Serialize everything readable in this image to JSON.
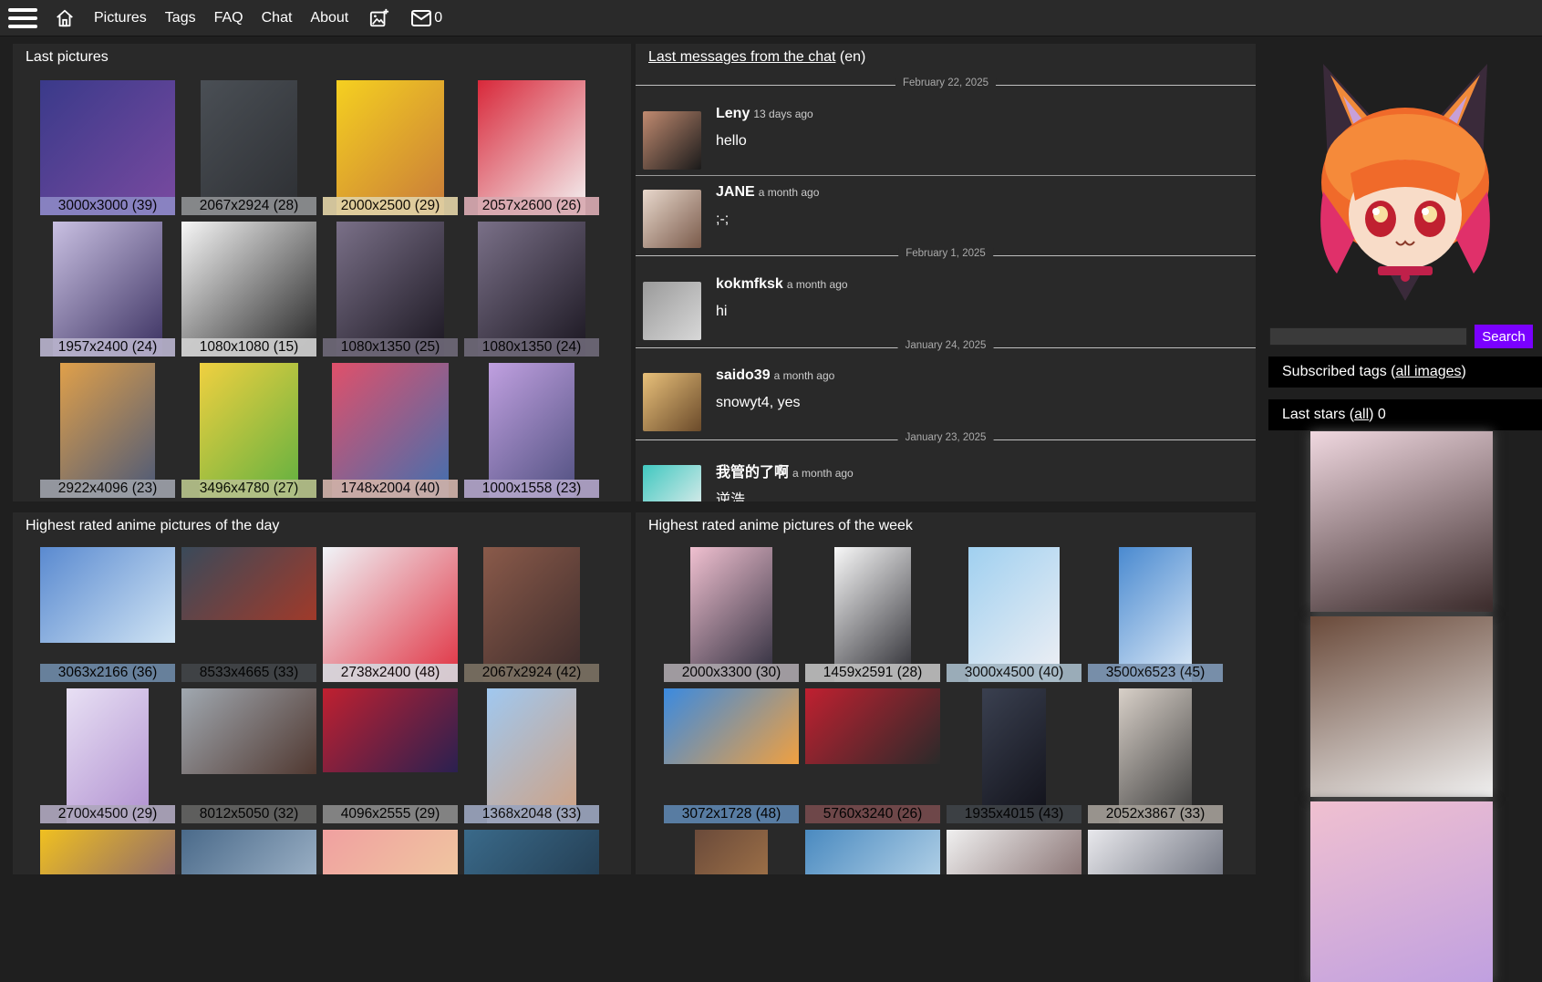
{
  "nav": {
    "links": [
      "Pictures",
      "Tags",
      "FAQ",
      "Chat",
      "About"
    ],
    "inbox_count": "0"
  },
  "last_pictures": {
    "title": "Last pictures",
    "items": [
      {
        "label": "3000x3000 (39)",
        "c1": "#3a3a8a",
        "c2": "#7a4aa0",
        "lbl": "#8b87c4",
        "w": 148,
        "h": 148
      },
      {
        "label": "2067x2924 (28)",
        "c1": "#4a4f55",
        "c2": "#2d2f33",
        "lbl": "#8d8f92",
        "w": 106,
        "h": 148
      },
      {
        "label": "2000x2500 (29)",
        "c1": "#f5d020",
        "c2": "#c87a3a",
        "lbl": "#e0d1a5",
        "w": 118,
        "h": 148
      },
      {
        "label": "2057x2600 (26)",
        "c1": "#d8283a",
        "c2": "#f4f4f4",
        "lbl": "#d8aab1",
        "w": 118,
        "h": 148
      },
      {
        "label": "1957x2400 (24)",
        "c1": "#c9c0e2",
        "c2": "#3a3060",
        "lbl": "#b8b2cc",
        "w": 120,
        "h": 148
      },
      {
        "label": "1080x1080 (15)",
        "c1": "#f6f6f6",
        "c2": "#222222",
        "lbl": "#cfcfcf",
        "w": 148,
        "h": 148
      },
      {
        "label": "1080x1350 (25)",
        "c1": "#7a7088",
        "c2": "#1a1620",
        "lbl": "#6e6878",
        "w": 118,
        "h": 148
      },
      {
        "label": "1080x1350 (24)",
        "c1": "#7a7088",
        "c2": "#1a1620",
        "lbl": "#6e6878",
        "w": 118,
        "h": 148
      },
      {
        "label": "2922x4096 (23)",
        "c1": "#e0a04a",
        "c2": "#4a5878",
        "lbl": "#9ca0a8",
        "w": 104,
        "h": 148
      },
      {
        "label": "3496x4780 (27)",
        "c1": "#f0d040",
        "c2": "#60b040",
        "lbl": "#b5c18a",
        "w": 108,
        "h": 148
      },
      {
        "label": "1748x2004 (40)",
        "c1": "#e0506a",
        "c2": "#4070b0",
        "lbl": "#cfb1a8",
        "w": 128,
        "h": 148
      },
      {
        "label": "1000x1558 (23)",
        "c1": "#c0a0e0",
        "c2": "#505080",
        "lbl": "#b1a4c9",
        "w": 94,
        "h": 148
      }
    ]
  },
  "chat": {
    "title_link": "Last messages from the chat",
    "title_suffix": " (en)",
    "dates": [
      "February 22, 2025",
      "February 1, 2025",
      "January 24, 2025",
      "January 23, 2025"
    ],
    "messages": [
      {
        "name": "Leny",
        "time": "13 days ago",
        "text": "hello",
        "c1": "#c08a70",
        "c2": "#1a1a1a"
      },
      {
        "name": "JANE",
        "time": "a month ago",
        "text": ";-;",
        "c1": "#e8d8cc",
        "c2": "#7a5a4a"
      },
      {
        "name": "kokmfksk",
        "time": "a month ago",
        "text": "hi",
        "c1": "#9a9a9a",
        "c2": "#d8d8d8"
      },
      {
        "name": "saido39",
        "time": "a month ago",
        "text": "snowyt4, yes",
        "c1": "#e8c07a",
        "c2": "#6a4a2a"
      },
      {
        "name": "我管的了啊",
        "time": "a month ago",
        "text": "逆浩",
        "c1": "#40c8c0",
        "c2": "#f0f0f0"
      }
    ]
  },
  "day_rated": {
    "title": "Highest rated anime pictures of the day",
    "items": [
      {
        "label": "3063x2166 (36)",
        "c1": "#5a8ad0",
        "c2": "#d0e4f4",
        "lbl": "#6d88a5",
        "w": 148,
        "h": 105
      },
      {
        "label": "8533x4665 (33)",
        "c1": "#3a4a5a",
        "c2": "#a03a2a",
        "lbl": "#414548",
        "w": 148,
        "h": 80
      },
      {
        "label": "2738x2400 (48)",
        "c1": "#f0f4f8",
        "c2": "#e03040",
        "lbl": "#d6d6dc",
        "w": 148,
        "h": 148
      },
      {
        "label": "2067x2924 (42)",
        "c1": "#8a5a4a",
        "c2": "#3a2a2a",
        "lbl": "#7a7062",
        "w": 106,
        "h": 148
      },
      {
        "label": "2700x4500 (29)",
        "c1": "#e8e0f4",
        "c2": "#b090d0",
        "lbl": "#aea6bd",
        "w": 90,
        "h": 148
      },
      {
        "label": "8012x5050 (32)",
        "c1": "#a0a8b0",
        "c2": "#503830",
        "lbl": "#636362",
        "w": 148,
        "h": 94
      },
      {
        "label": "4096x2555 (29)",
        "c1": "#c02030",
        "c2": "#2a2050",
        "lbl": "#8a8a8a",
        "w": 148,
        "h": 92
      },
      {
        "label": "1368x2048 (33)",
        "c1": "#a0c8f0",
        "c2": "#d0a080",
        "lbl": "#9aa4bd",
        "w": 98,
        "h": 148
      }
    ],
    "row3": [
      {
        "c1": "#f0c020",
        "c2": "#604090",
        "w": 148
      },
      {
        "c1": "#4a6a8a",
        "c2": "#c0d0e0",
        "w": 148
      },
      {
        "c1": "#f0a0a0",
        "c2": "#f0d8a0",
        "w": 148
      },
      {
        "c1": "#3a6a8a",
        "c2": "#1a2a3a",
        "w": 148
      }
    ]
  },
  "week_rated": {
    "title": "Highest rated anime pictures of the week",
    "items": [
      {
        "label": "2000x3300 (30)",
        "c1": "#f0c0d0",
        "c2": "#2a2a3a",
        "lbl": "#a9a4a9",
        "w": 90,
        "h": 148
      },
      {
        "label": "1459x2591 (28)",
        "c1": "#f8f8f8",
        "c2": "#2a2a30",
        "lbl": "#bdbdbd",
        "w": 84,
        "h": 148
      },
      {
        "label": "3000x4500 (40)",
        "c1": "#a0d0f0",
        "c2": "#f0f0f4",
        "lbl": "#a4b8c5",
        "w": 100,
        "h": 148
      },
      {
        "label": "3500x6523 (45)",
        "c1": "#4a8ad0",
        "c2": "#e0ecf8",
        "lbl": "#7e97b4",
        "w": 80,
        "h": 148
      },
      {
        "label": "3072x1728 (48)",
        "c1": "#3a8ae0",
        "c2": "#f0a040",
        "lbl": "#5d84ad",
        "w": 148,
        "h": 83
      },
      {
        "label": "5760x3240 (26)",
        "c1": "#c02030",
        "c2": "#2a2a2a",
        "lbl": "#744a4c",
        "w": 148,
        "h": 83
      },
      {
        "label": "1935x4015 (43)",
        "c1": "#3a4050",
        "c2": "#101018",
        "lbl": "#3e4247",
        "w": 70,
        "h": 148
      },
      {
        "label": "2052x3867 (33)",
        "c1": "#d8d0c8",
        "c2": "#3a3a3a",
        "lbl": "#a29d96",
        "w": 80,
        "h": 148
      }
    ],
    "row3": [
      {
        "c1": "#6a4a3a",
        "c2": "#c08a50",
        "w": 80
      },
      {
        "c1": "#4a8ac0",
        "c2": "#e0f0f8",
        "w": 148
      },
      {
        "c1": "#f0f0f0",
        "c2": "#5a3a3a",
        "w": 148
      },
      {
        "c1": "#e8e8ec",
        "c2": "#3a4050",
        "w": 148
      }
    ]
  },
  "sidebar": {
    "search_button": "Search",
    "subscribed": {
      "prefix": "Subscribed tags (",
      "link": "all images",
      "suffix": ")"
    },
    "stars": {
      "prefix": "Last stars (",
      "link": "all",
      "suffix": ") 0"
    },
    "star_items": [
      {
        "c1": "#f0d8e0",
        "c2": "#3a2a2a"
      },
      {
        "c1": "#6a4a3a",
        "c2": "#f0f0f0"
      },
      {
        "c1": "#f0c0d0",
        "c2": "#c0a0e0"
      }
    ]
  }
}
